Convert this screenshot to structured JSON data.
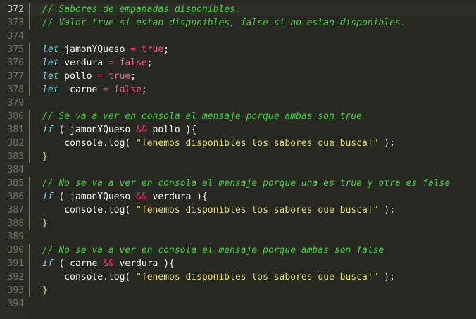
{
  "editor": {
    "lines": [
      {
        "n": "372",
        "cur": true,
        "mk": true,
        "t": [
          [
            "cm",
            "// Sabores de empanadas disponibles."
          ]
        ]
      },
      {
        "n": "373",
        "mk": true,
        "t": [
          [
            "cm",
            "// Valor true si estan disponibles, false si no estan disponibles."
          ]
        ]
      },
      {
        "n": "374",
        "t": []
      },
      {
        "n": "375",
        "mk": true,
        "t": [
          [
            "kw",
            "let"
          ],
          [
            "pn",
            " jamonYQueso "
          ],
          [
            "op",
            "="
          ],
          [
            "pn",
            " "
          ],
          [
            "bool",
            "true"
          ],
          [
            "pn",
            ";"
          ]
        ]
      },
      {
        "n": "376",
        "mk": true,
        "t": [
          [
            "kw",
            "let"
          ],
          [
            "pn",
            " verdura "
          ],
          [
            "op",
            "="
          ],
          [
            "pn",
            " "
          ],
          [
            "bool",
            "false"
          ],
          [
            "pn",
            ";"
          ]
        ]
      },
      {
        "n": "377",
        "mk": true,
        "t": [
          [
            "kw",
            "let"
          ],
          [
            "pn",
            " pollo "
          ],
          [
            "op",
            "="
          ],
          [
            "pn",
            " "
          ],
          [
            "bool",
            "true"
          ],
          [
            "pn",
            ";"
          ]
        ]
      },
      {
        "n": "378",
        "mk": true,
        "t": [
          [
            "kw",
            "let"
          ],
          [
            "pn",
            "  carne "
          ],
          [
            "op",
            "="
          ],
          [
            "pn",
            " "
          ],
          [
            "bool",
            "false"
          ],
          [
            "pn",
            ";"
          ]
        ]
      },
      {
        "n": "379",
        "t": []
      },
      {
        "n": "380",
        "mk": true,
        "t": [
          [
            "cm",
            "// Se va a ver en consola el mensaje porque ambas son true"
          ]
        ]
      },
      {
        "n": "381",
        "mk": true,
        "t": [
          [
            "kw",
            "if"
          ],
          [
            "pn",
            " ( jamonYQueso "
          ],
          [
            "op",
            "&&"
          ],
          [
            "pn",
            " pollo ){"
          ]
        ]
      },
      {
        "n": "382",
        "mk": true,
        "t": [
          [
            "pn",
            "    console."
          ],
          [
            "fn",
            "log"
          ],
          [
            "pn",
            "( "
          ],
          [
            "str",
            "\"Tenemos disponibles los sabores que busca!\""
          ],
          [
            "pn",
            " );"
          ]
        ]
      },
      {
        "n": "383",
        "mk": true,
        "t": [
          [
            "brace",
            "}"
          ]
        ]
      },
      {
        "n": "384",
        "t": []
      },
      {
        "n": "385",
        "mk": true,
        "t": [
          [
            "cm",
            "// No se va a ver en consola el mensaje porque una es true y otra es false"
          ]
        ]
      },
      {
        "n": "386",
        "mk": true,
        "t": [
          [
            "kw",
            "if"
          ],
          [
            "pn",
            " ( jamonYQueso "
          ],
          [
            "op",
            "&&"
          ],
          [
            "pn",
            " verdura ){"
          ]
        ]
      },
      {
        "n": "387",
        "mk": true,
        "t": [
          [
            "pn",
            "    console."
          ],
          [
            "fn",
            "log"
          ],
          [
            "pn",
            "( "
          ],
          [
            "str",
            "\"Tenemos disponibles los sabores que busca!\""
          ],
          [
            "pn",
            " );"
          ]
        ]
      },
      {
        "n": "388",
        "mk": true,
        "t": [
          [
            "brace",
            "}"
          ]
        ]
      },
      {
        "n": "389",
        "t": []
      },
      {
        "n": "390",
        "mk": true,
        "t": [
          [
            "cm",
            "// No se va a ver en consola el mensaje porque ambas son false"
          ]
        ]
      },
      {
        "n": "391",
        "mk": true,
        "t": [
          [
            "kw",
            "if"
          ],
          [
            "pn",
            " ( carne "
          ],
          [
            "op",
            "&&"
          ],
          [
            "pn",
            " verdura ){"
          ]
        ]
      },
      {
        "n": "392",
        "mk": true,
        "t": [
          [
            "pn",
            "    console."
          ],
          [
            "fn",
            "log"
          ],
          [
            "pn",
            "( "
          ],
          [
            "str",
            "\"Tenemos disponibles los sabores que busca!\""
          ],
          [
            "pn",
            " );"
          ]
        ]
      },
      {
        "n": "393",
        "mk": true,
        "t": [
          [
            "brace",
            "}"
          ]
        ]
      },
      {
        "n": "394",
        "t": []
      }
    ]
  },
  "colors": {
    "background": "#272822",
    "comment": "#42d13e",
    "keyword": "#66d9ef",
    "operator": "#f92672",
    "string": "#e6db74",
    "text": "#f8f8f2"
  }
}
